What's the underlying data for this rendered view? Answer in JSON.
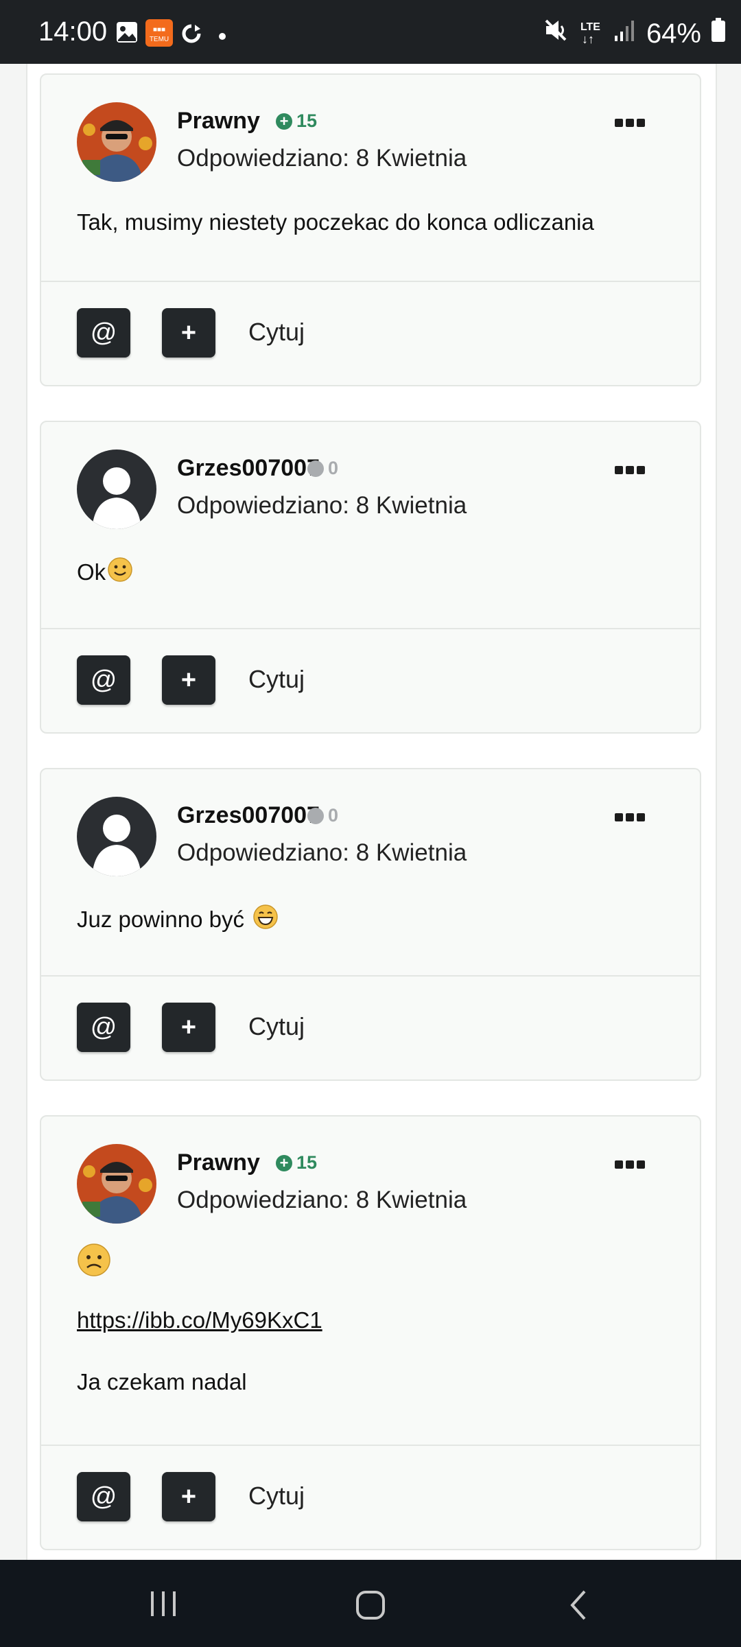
{
  "status_bar": {
    "time": "14:00",
    "battery": "64%",
    "network": "LTE"
  },
  "posts": [
    {
      "author": "Prawny",
      "reputation": "15",
      "answered": "Odpowiedziano: 8 Kwietnia",
      "lines": [
        "Tak, musimy niestety poczekac do konca odliczania"
      ],
      "actions": {
        "mention": "@",
        "plus": "+",
        "quote": "Cytuj"
      }
    },
    {
      "author": "Grzes007007",
      "reputation": "0",
      "answered": "Odpowiedziano: 8 Kwietnia",
      "lines": [
        "Ok"
      ],
      "actions": {
        "mention": "@",
        "plus": "+",
        "quote": "Cytuj"
      }
    },
    {
      "author": "Grzes007007",
      "reputation": "0",
      "answered": "Odpowiedziano: 8 Kwietnia",
      "lines": [
        "Juz powinno być"
      ],
      "actions": {
        "mention": "@",
        "plus": "+",
        "quote": "Cytuj"
      }
    },
    {
      "author": "Prawny",
      "reputation": "15",
      "answered": "Odpowiedziano: 8 Kwietnia",
      "lines": [
        "https://ibb.co/My69KxC1",
        "Ja czekam nadal"
      ],
      "actions": {
        "mention": "@",
        "plus": "+",
        "quote": "Cytuj"
      }
    }
  ],
  "icons": {
    "status_left": [
      "gallery-icon",
      "temu-app-icon",
      "sync-icon",
      "notification-dot-icon"
    ],
    "status_right": [
      "mute-icon",
      "lte-icon",
      "signal-icon",
      "battery-icon"
    ],
    "nav": [
      "recent-apps-icon",
      "home-icon",
      "back-icon"
    ]
  },
  "colors": {
    "positive_reputation": "#2f8a5e",
    "neutral_reputation": "#a9acaf",
    "button_dark": "#23272a"
  }
}
